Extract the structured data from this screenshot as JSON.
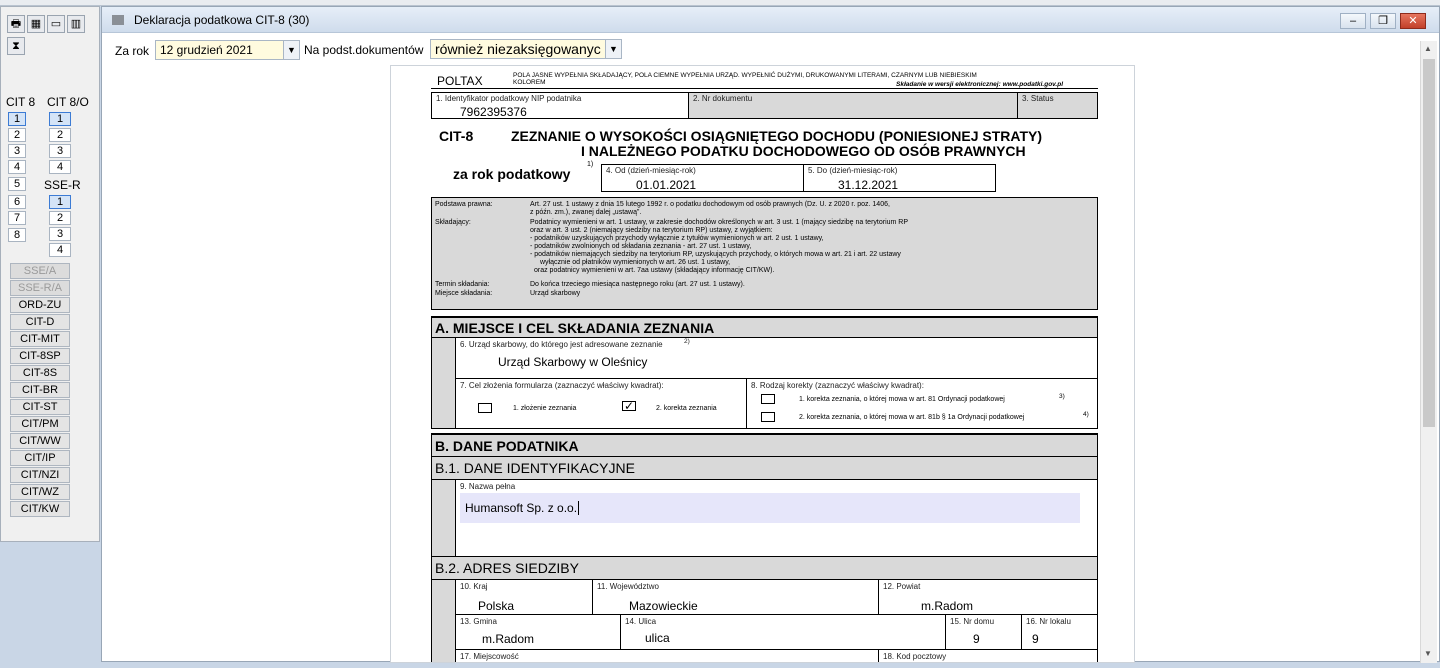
{
  "left_panel": {
    "toolbar_icons": [
      "printer-icon",
      "calendar-icon",
      "window-icon",
      "book-icon",
      "hourglass-icon"
    ],
    "col_cit8": "CIT 8",
    "col_cit8o": "CIT 8/O",
    "col_sser": "SSE-R",
    "cit8_numbers": [
      "1",
      "2",
      "3",
      "4",
      "5",
      "6",
      "7",
      "8"
    ],
    "cit8o_numbers": [
      "1",
      "2",
      "3",
      "4"
    ],
    "sser_numbers": [
      "1",
      "2",
      "3",
      "4"
    ],
    "side_buttons": [
      "SSE/A",
      "SSE-R/A",
      "ORD-ZU",
      "CIT-D",
      "CIT-MIT",
      "CIT-8SP",
      "CIT-8S",
      "CIT-BR",
      "CIT-ST",
      "CIT/PM",
      "CIT/WW",
      "CIT/IP",
      "CIT/NZI",
      "CIT/WZ",
      "CIT/KW"
    ]
  },
  "window": {
    "title": "Deklaracja podatkowa CIT-8 (30)",
    "controls": {
      "minimize": "–",
      "restore": "❐",
      "close": "✕"
    },
    "za_rok_label": "Za rok",
    "za_rok_value": "12 grudzień 2021",
    "na_podst_label": "Na podst.dokumentów",
    "na_podst_value": "również niezaksięgowanyc"
  },
  "form": {
    "poltax": "POLTAX",
    "instr1": "POLA JASNE WYPEŁNIA SKŁADAJĄCY, POLA CIEMNE WYPEŁNIA URZĄD. WYPEŁNIĆ DUŻYMI, DRUKOWANYMI LITERAMI, CZARNYM LUB NIEBIESKIM",
    "instr2": "KOLOREM",
    "instr3": "Składanie w wersji elektronicznej: www.podatki.gov.pl",
    "f1_label": "1. Identyfikator podatkowy NIP podatnika",
    "f1_value": "7962395376",
    "f2_label": "2. Nr dokumentu",
    "f3_label": "3. Status",
    "code": "CIT-8",
    "heading1": "ZEZNANIE O WYSOKOŚCI OSIĄGNIĘTEGO DOCHODU (PONIESIONEJ STRATY)",
    "heading2": "I NALEŻNEGO PODATKU DOCHODOWEGO OD OSÓB PRAWNYCH",
    "za_rok_podatkowy": "za rok podatkowy",
    "za_rok_sup": "1)",
    "f4_label": "4. Od (dzień-miesiąc-rok)",
    "f4_value": "01.01.2021",
    "f5_label": "5. Do (dzień-miesiąc-rok)",
    "f5_value": "31.12.2021",
    "legal": {
      "podstawa_label": "Podstawa prawna:",
      "podstawa_text1": "Art. 27 ust. 1 ustawy z dnia 15 lutego 1992 r. o podatku dochodowym od osób prawnych (Dz. U. z 2020 r. poz. 1406,",
      "podstawa_text2": "z późn. zm.), zwanej dalej „ustawą”.",
      "skladajacy_label": "Składający:",
      "sk1": "Podatnicy wymienieni w art. 1 ustawy, w zakresie dochodów określonych w art. 3 ust. 1 (mający siedzibę na terytorium RP",
      "sk2": "oraz w art. 3 ust. 2 (niemający siedziby na terytorium RP) ustawy, z wyjątkiem:",
      "sk3": "- podatników uzyskujących przychody wyłącznie z tytułów wymienionych w art. 2 ust. 1 ustawy,",
      "sk4": "- podatników zwolnionych od składania zeznania - art. 27 ust. 1 ustawy,",
      "sk5": "- podatników niemających siedziby na terytorium RP, uzyskujących przychody, o których mowa w art. 21 i art. 22 ustawy",
      "sk6": "wyłącznie od płatników wymienionych w art. 26 ust. 1 ustawy,",
      "sk7": "oraz podatnicy wymienieni w art. 7aa ustawy (składający informację CIT/KW).",
      "termin_label": "Termin składania:",
      "termin_text": "Do końca trzeciego miesiąca następnego roku (art. 27 ust. 1 ustawy).",
      "miejsce_label": "Miejsce składania:",
      "miejsce_text": "Urząd skarbowy"
    },
    "secA": "A. MIEJSCE I CEL SKŁADANIA ZEZNANIA",
    "f6_label": "6. Urząd skarbowy, do którego jest adresowane zeznanie",
    "f6_sup": "2)",
    "f6_value": "Urząd Skarbowy w Oleśnicy",
    "f7_label": "7. Cel złożenia formularza (zaznaczyć właściwy kwadrat):",
    "f7_opt1": "1. złożenie zeznania",
    "f7_opt2": "2. korekta zeznania",
    "f7_checked": "✓",
    "f8_label": "8. Rodzaj korekty (zaznaczyć właściwy kwadrat):",
    "f8_opt1": "1. korekta zeznania, o której mowa w art. 81 Ordynacji podatkowej",
    "f8_sup1": "3)",
    "f8_opt2": "2. korekta zeznania, o której mowa w art. 81b § 1a Ordynacji podatkowej",
    "f8_sup2": "4)",
    "secB": "B. DANE PODATNIKA",
    "secB1": "B.1. DANE IDENTYFIKACYJNE",
    "f9_label": "9. Nazwa pełna",
    "f9_value": "Humansoft Sp. z o.o.",
    "secB2": "B.2. ADRES SIEDZIBY",
    "f10_label": "10. Kraj",
    "f10_value": "Polska",
    "f11_label": "11. Województwo",
    "f11_value": "Mazowieckie",
    "f12_label": "12. Powiat",
    "f12_value": "m.Radom",
    "f13_label": "13. Gmina",
    "f13_value": "m.Radom",
    "f14_label": "14. Ulica",
    "f14_value": "ulica",
    "f15_label": "15. Nr domu",
    "f15_value": "9",
    "f16_label": "16. Nr lokalu",
    "f16_value": "9",
    "f17_label": "17. Miejscowość",
    "f18_label": "18. Kod pocztowy"
  }
}
